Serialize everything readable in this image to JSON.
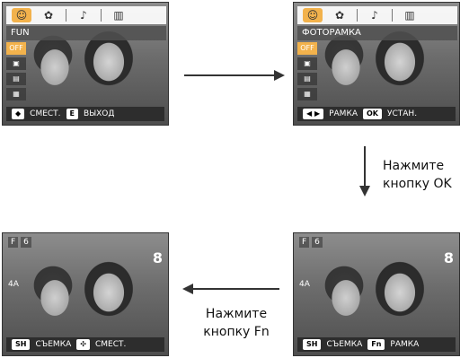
{
  "screens": {
    "topLeft": {
      "tabs": [
        "☺",
        "✿",
        "♪",
        "▥"
      ],
      "menu_title": "FUN",
      "menu_items": [
        "OFF",
        "▣",
        "▤",
        "▦"
      ],
      "bottom_bar": [
        {
          "key": "◆",
          "label": "СМЕСТ."
        },
        {
          "key": "E",
          "label": "ВЫХОД"
        }
      ]
    },
    "topRight": {
      "tabs": [
        "☺",
        "✿",
        "♪",
        "▥"
      ],
      "menu_title": "ФОТОРАМКА",
      "menu_items": [
        "OFF",
        "▣",
        "▤",
        "▦"
      ],
      "bottom_bar": [
        {
          "key": "◀ ▶",
          "label": "РАМКА"
        },
        {
          "key": "OK",
          "label": "УСТАН."
        }
      ]
    },
    "bottomRight": {
      "top_left_icons": [
        "F",
        "6"
      ],
      "right_big": "8",
      "left_flash": "4A",
      "bottom_bar": [
        {
          "key": "SH",
          "label": "СЪЕМКА"
        },
        {
          "key": "Fn",
          "label": "РАМКА"
        }
      ]
    },
    "bottomLeft": {
      "top_left_icons": [
        "F",
        "6"
      ],
      "right_big": "8",
      "left_flash": "4A",
      "bottom_bar": [
        {
          "key": "SH",
          "label": "СЪЕМКА"
        },
        {
          "key": "✣",
          "label": "СМЕСТ."
        }
      ]
    }
  },
  "labels": {
    "right_top_line1": "Нажмите",
    "right_top_line2": "кнопку OK",
    "bottom_mid_line1": "Нажмите",
    "bottom_mid_line2": "кнопку Fn"
  }
}
